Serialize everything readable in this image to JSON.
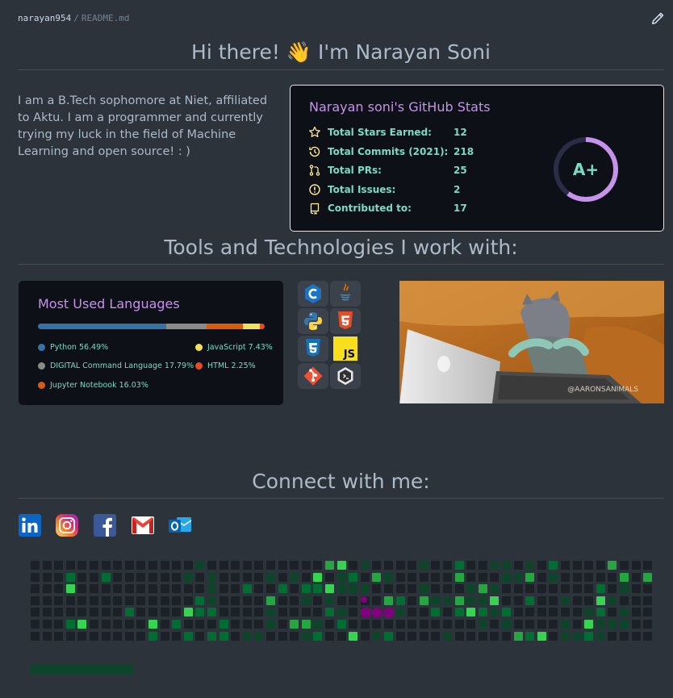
{
  "breadcrumb": {
    "owner": "narayan954",
    "separator": "/",
    "file": "README.md"
  },
  "header": {
    "greeting_prefix": "Hi there!",
    "wave_emoji": "👋",
    "greeting_suffix": "I'm Narayan Soni"
  },
  "intro": "I am a B.Tech sophomore at Niet, affiliated to Aktu. I am a programmer and currently trying my luck in the field of Machine Learning and open source! : )",
  "stats": {
    "title": "Narayan soni's GitHub Stats",
    "rank": "A+",
    "rank_progress_percent": 60,
    "rows": [
      {
        "icon": "star-icon",
        "label": "Total Stars Earned:",
        "value": "12"
      },
      {
        "icon": "history-icon",
        "label": "Total Commits (2021):",
        "value": "218"
      },
      {
        "icon": "pull-request-icon",
        "label": "Total PRs:",
        "value": "25"
      },
      {
        "icon": "issue-icon",
        "label": "Total Issues:",
        "value": "2"
      },
      {
        "icon": "repo-icon",
        "label": "Contributed to:",
        "value": "17"
      }
    ]
  },
  "tools_heading": "Tools and Technologies I work with:",
  "languages": {
    "title": "Most Used Languages",
    "items": [
      {
        "label": "Python 56.49%",
        "percent": 56.49,
        "color": "#3572A5"
      },
      {
        "label": "DIGITAL Command Language 17.79%",
        "percent": 17.79,
        "color": "#8a8a8a"
      },
      {
        "label": "Jupyter Notebook 16.03%",
        "percent": 16.03,
        "color": "#DA5B0B"
      },
      {
        "label": "JavaScript 7.43%",
        "percent": 7.43,
        "color": "#f1e05a"
      },
      {
        "label": "HTML 2.25%",
        "percent": 2.25,
        "color": "#e34c26"
      }
    ]
  },
  "tech_icons": [
    "c-icon",
    "java-icon",
    "python-icon",
    "html5-icon",
    "css3-icon",
    "javascript-icon",
    "git-icon",
    "bash-icon"
  ],
  "tech_js_label": "JS",
  "gif": {
    "name": "cat-typing-gif",
    "watermark": "@AARONSANIMALS"
  },
  "connect_heading": "Connect with me:",
  "socials": [
    "linkedin-icon",
    "instagram-icon",
    "facebook-icon",
    "gmail-icon",
    "outlook-icon"
  ],
  "colors": {
    "accent": "#c792ea",
    "text": "#79dbc1",
    "card_bg": "#0d1117",
    "page_bg": "#2d333b"
  }
}
